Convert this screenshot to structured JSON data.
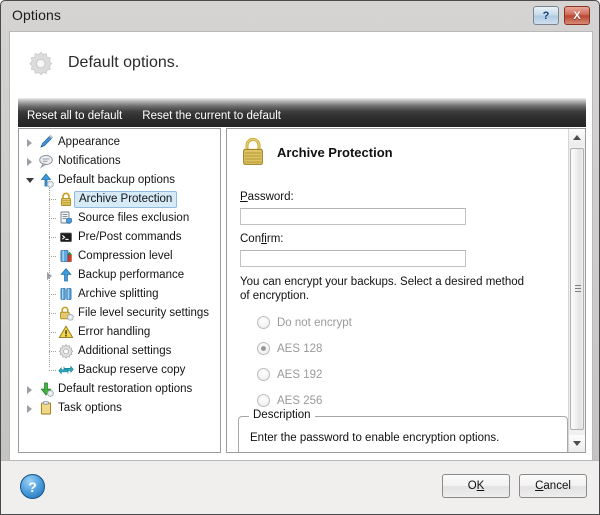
{
  "window": {
    "title": "Options",
    "titlebar_buttons": [
      {
        "name": "help-button",
        "glyph": "?"
      },
      {
        "name": "close-button",
        "glyph": "X"
      }
    ]
  },
  "header": {
    "icon": "gear-icon",
    "title": "Default options."
  },
  "toolbar": {
    "reset_all_label": "Reset all to default",
    "reset_current_label": "Reset the current to default"
  },
  "tree": {
    "items": [
      {
        "label": "Appearance",
        "level": 0,
        "icon": "brush-icon",
        "twist": "closed",
        "selected": false
      },
      {
        "label": "Notifications",
        "level": 0,
        "icon": "speech-bubble-icon",
        "twist": "closed",
        "selected": false
      },
      {
        "label": "Default backup options",
        "level": 0,
        "icon": "blue-up-arrow-gear-icon",
        "twist": "open",
        "selected": false
      },
      {
        "label": "Archive Protection",
        "level": 1,
        "icon": "padlock-icon",
        "twist": "none",
        "selected": true
      },
      {
        "label": "Source files exclusion",
        "level": 1,
        "icon": "document-shield-icon",
        "twist": "none",
        "selected": false
      },
      {
        "label": "Pre/Post commands",
        "level": 1,
        "icon": "console-icon",
        "twist": "none",
        "selected": false
      },
      {
        "label": "Compression level",
        "level": 1,
        "icon": "compression-icon",
        "twist": "none",
        "selected": false
      },
      {
        "label": "Backup performance",
        "level": 1,
        "icon": "blue-up-arrow-icon",
        "twist": "closed",
        "selected": false
      },
      {
        "label": "Archive splitting",
        "level": 1,
        "icon": "split-archive-icon",
        "twist": "none",
        "selected": false
      },
      {
        "label": "File level security settings",
        "level": 1,
        "icon": "padlock-gear-icon",
        "twist": "none",
        "selected": false
      },
      {
        "label": "Error handling",
        "level": 1,
        "icon": "warning-triangle-icon",
        "twist": "none",
        "selected": false
      },
      {
        "label": "Additional settings",
        "level": 1,
        "icon": "gear-icon",
        "twist": "none",
        "selected": false
      },
      {
        "label": "Backup reserve copy",
        "level": 1,
        "icon": "double-arrow-icon",
        "twist": "none",
        "selected": false
      },
      {
        "label": "Default restoration options",
        "level": 0,
        "icon": "green-down-arrow-gear-icon",
        "twist": "closed",
        "selected": false
      },
      {
        "label": "Task options",
        "level": 0,
        "icon": "clipboard-icon",
        "twist": "closed",
        "selected": false
      }
    ]
  },
  "panel": {
    "icon": "padlock-icon",
    "title": "Archive Protection",
    "password_label": "Password:",
    "password_accesskey": "P",
    "password_value": "",
    "confirm_label": "Confirm:",
    "confirm_accesskey": "fi",
    "confirm_value": "",
    "encryption_hint": "You can encrypt your backups. Select a desired method of encryption.",
    "encryption_options": [
      {
        "label": "Do not encrypt",
        "checked": false,
        "disabled": true
      },
      {
        "label": "AES 128",
        "checked": true,
        "disabled": true
      },
      {
        "label": "AES 192",
        "checked": false,
        "disabled": true
      },
      {
        "label": "AES 256",
        "checked": false,
        "disabled": true
      }
    ],
    "description_legend": "Description",
    "description_text": "Enter the password to enable encryption options."
  },
  "scrollbar": {
    "up_glyph": "▲",
    "down_glyph": "▼"
  },
  "footer": {
    "help_glyph": "?",
    "ok_label": "OK",
    "ok_accesskey": "K",
    "cancel_label": "Cancel",
    "cancel_accesskey": "C"
  },
  "colors": {
    "accent": "#d6eaf8",
    "selection_border": "#8fbce0",
    "toolbar_dark": "#242424",
    "lock_gold": "#c9a227"
  }
}
